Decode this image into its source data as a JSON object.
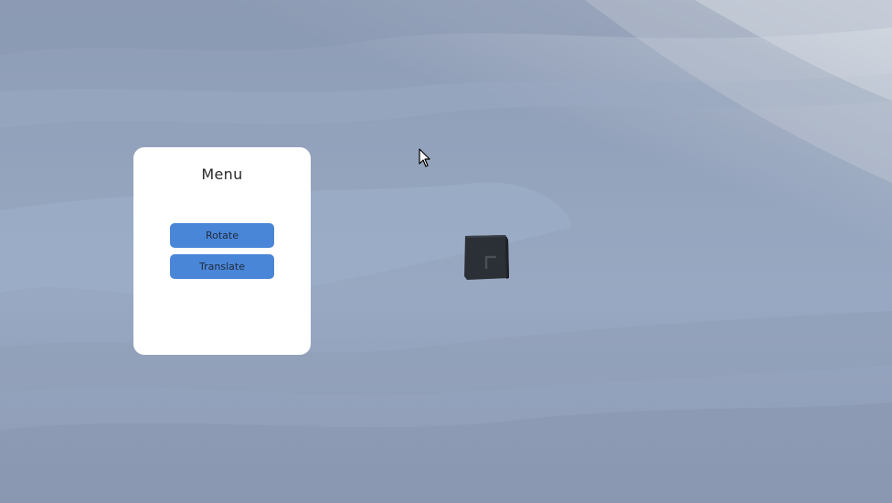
{
  "menu": {
    "title": "Menu",
    "buttons": [
      {
        "label": "Rotate"
      },
      {
        "label": "Translate"
      }
    ]
  },
  "scene": {
    "object": "cube",
    "object_color": "#2b2f36",
    "background_color": "#94a3bb"
  },
  "colors": {
    "button": "#4a86d8",
    "panel": "#ffffff"
  }
}
